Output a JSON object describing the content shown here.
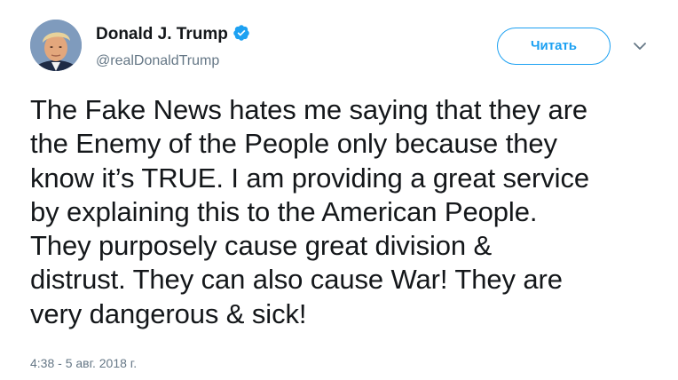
{
  "tweet": {
    "author": {
      "display_name": "Donald J. Trump",
      "handle": "@realDonaldTrump",
      "verified": true,
      "avatar_icon": "profile-photo"
    },
    "follow_button_label": "Читать",
    "menu_icon": "chevron-down-icon",
    "text": "The Fake News hates me saying that they are\nthe Enemy of the People only because they\nknow it’s TRUE. I am providing a great service\nby explaining this to the American People.\nThey purposely cause great division &\ndistrust. They can also cause War! They are\nvery dangerous & sick!",
    "timestamp": "4:38 - 5 авг. 2018 г."
  },
  "colors": {
    "accent": "#1da1f2",
    "text": "#14171a",
    "secondary_text": "#657786"
  }
}
